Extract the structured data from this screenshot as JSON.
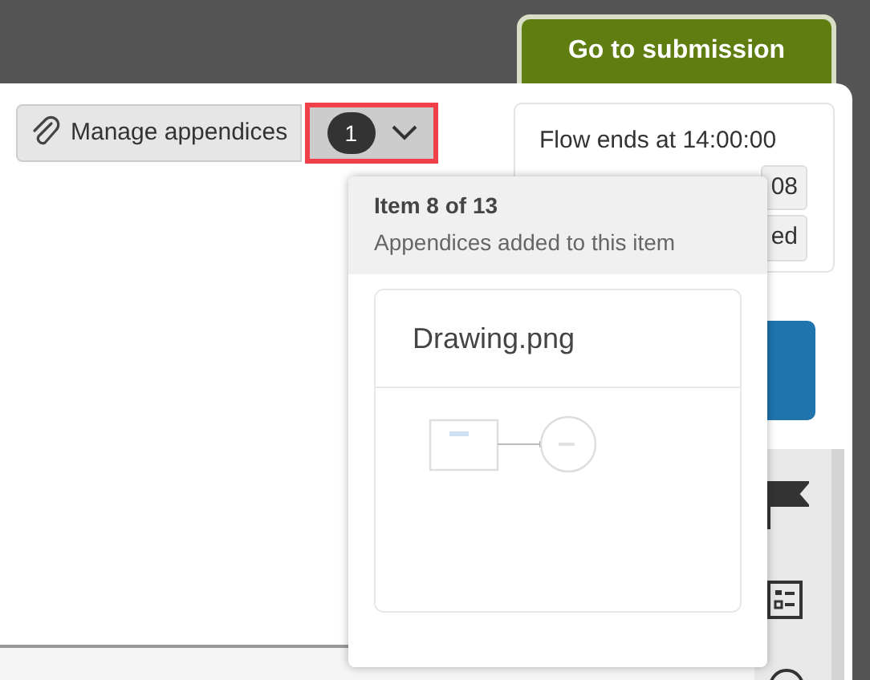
{
  "header": {
    "submission_button": "Go to submission"
  },
  "toolbar": {
    "appendices_button": "Manage appendices",
    "appendix_count": "1",
    "highlighted": true,
    "expanded": true
  },
  "timer": {
    "flow_end": "Flow ends at 14:00:00",
    "time_left": "08",
    "status": "ed"
  },
  "appendices_popover": {
    "title": "Item 8 of 13",
    "subtitle": "Appendices added to this item",
    "files": [
      {
        "name": "Drawing.png"
      }
    ]
  }
}
